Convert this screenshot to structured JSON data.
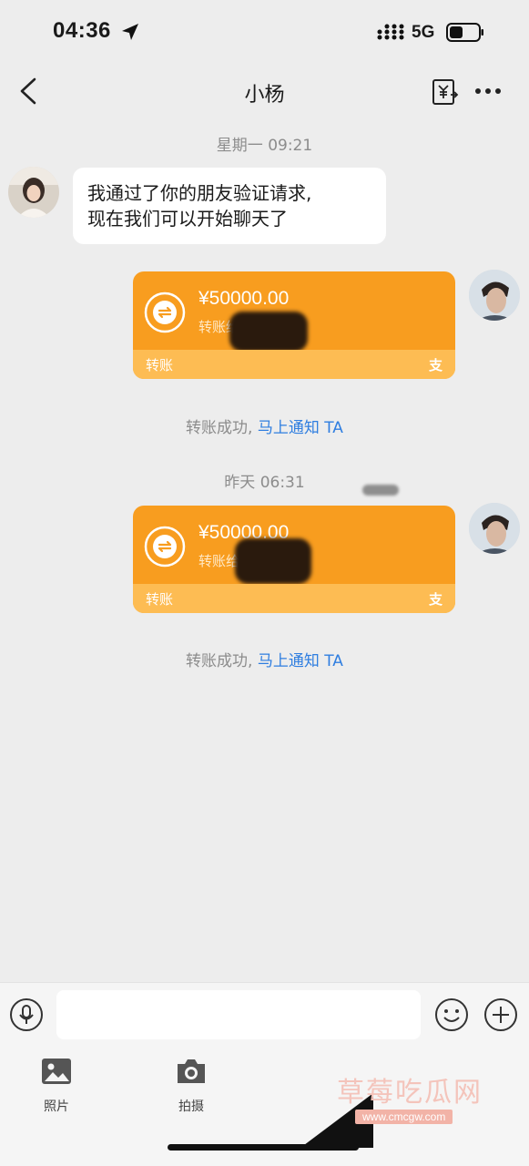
{
  "status_bar": {
    "time": "04:36",
    "network": "5G"
  },
  "nav": {
    "title": "小杨"
  },
  "messages": {
    "timestamp1": "星期一 09:21",
    "text_line1": "我通过了你的朋友验证请求,",
    "text_line2": "现在我们可以开始聊天了",
    "transfer1": {
      "amount": "¥50000.00",
      "sub": "转账给",
      "footer": "转账",
      "brand": "支"
    },
    "notice1": {
      "text": "转账成功,",
      "link": "马上通知 TA"
    },
    "timestamp2": "昨天 06:31",
    "transfer2": {
      "amount": "¥50000.00",
      "sub": "转账给",
      "footer": "转账",
      "brand": "支"
    },
    "notice2": {
      "text": "转账成功,",
      "link": "马上通知 TA"
    }
  },
  "input": {
    "placeholder": ""
  },
  "tools": [
    {
      "label": "照片",
      "icon": "photo-icon"
    },
    {
      "label": "拍摄",
      "icon": "camera-icon"
    }
  ],
  "watermark": {
    "text": "草莓吃瓜网",
    "url": "www.cmcgw.com"
  },
  "colors": {
    "card": "#f89d1f",
    "card_footer": "#fdbc53",
    "link": "#2f7ee0",
    "background": "#ededed"
  }
}
